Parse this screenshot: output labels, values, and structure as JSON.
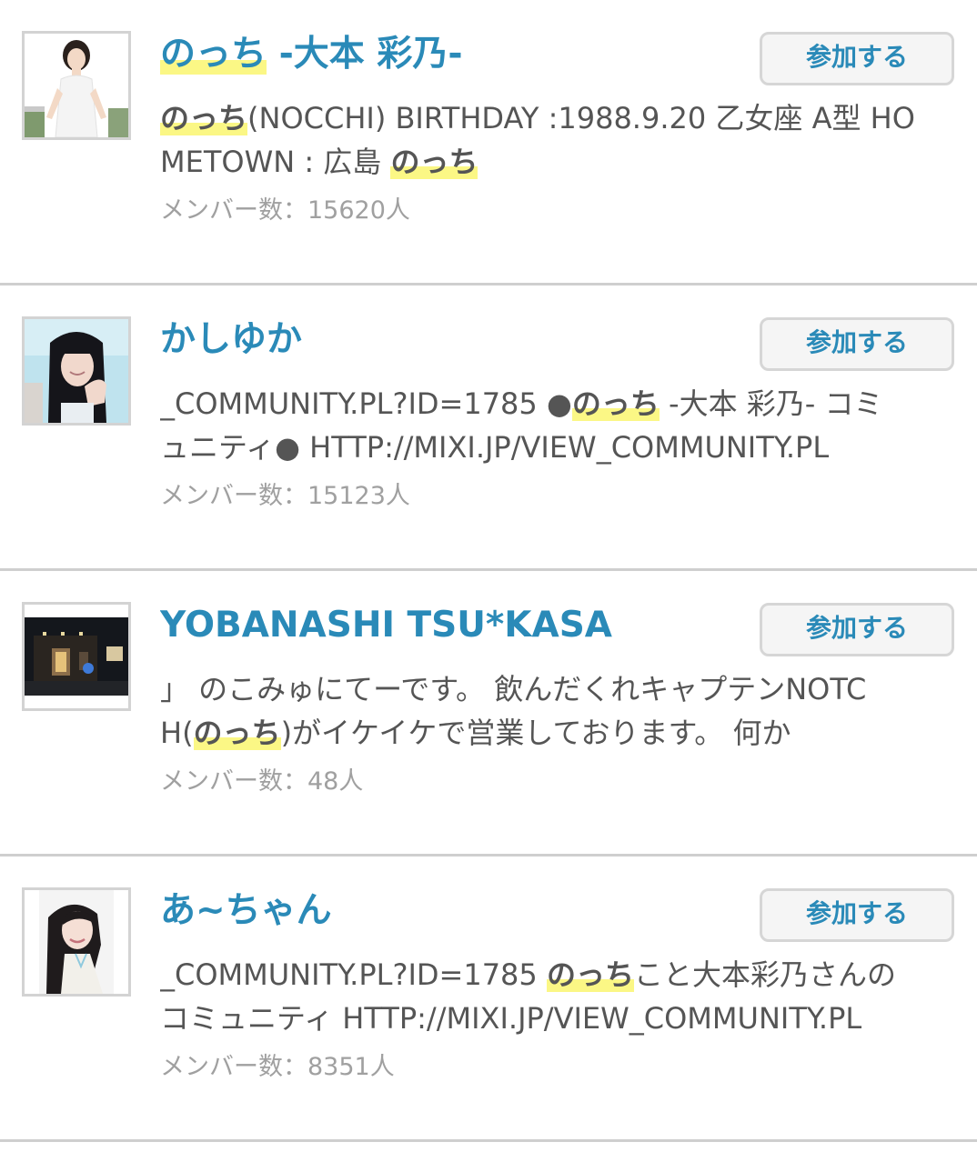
{
  "items": [
    {
      "thumbnail_icon": "woman-white-dress-photo",
      "title_highlight": "のっち",
      "title_rest": " -大本 彩乃-",
      "join_label": "参加する",
      "desc_line1": [
        {
          "text": "のっち",
          "hl": true
        },
        {
          "text": "(NOCCHI) BIRTHDAY :1988.9.20 乙女座 A型 HO",
          "hl": false
        }
      ],
      "desc_line2": [
        {
          "text": "METOWN : 広島 ",
          "hl": false
        },
        {
          "text": "のっち",
          "hl": true
        }
      ],
      "member_count": "メンバー数：15620人"
    },
    {
      "thumbnail_icon": "woman-black-hair-photo",
      "title_highlight": "",
      "title_rest": "かしゆか",
      "join_label": "参加する",
      "desc_line1": [
        {
          "text": "_COMMUNITY.PL?ID=1785 ●",
          "hl": false
        },
        {
          "text": "のっち",
          "hl": true
        },
        {
          "text": " -大本 彩乃- コミ",
          "hl": false
        }
      ],
      "desc_line2": [
        {
          "text": "ュニティ● HTTP://MIXI.JP/VIEW_COMMUNITY.PL",
          "hl": false
        }
      ],
      "member_count": "メンバー数：15123人"
    },
    {
      "thumbnail_icon": "night-building-photo",
      "title_highlight": "",
      "title_rest": "YOBANASHI TSU*KASA",
      "join_label": "参加する",
      "desc_line1": [
        {
          "text": "」 のこみゅにてーです。 飲んだくれキャプテンNOTC",
          "hl": false
        }
      ],
      "desc_line2": [
        {
          "text": "H(",
          "hl": false
        },
        {
          "text": "のっち",
          "hl": true
        },
        {
          "text": ")がイケイケで営業しております。 何か",
          "hl": false
        }
      ],
      "member_count": "メンバー数：48人"
    },
    {
      "thumbnail_icon": "smiling-woman-photo",
      "title_highlight": "",
      "title_rest": "あ~ちゃん",
      "join_label": "参加する",
      "desc_line1": [
        {
          "text": "_COMMUNITY.PL?ID=1785 ",
          "hl": false
        },
        {
          "text": "のっち",
          "hl": true
        },
        {
          "text": "こと大本彩乃さんの",
          "hl": false
        }
      ],
      "desc_line2": [
        {
          "text": "コミュニティ HTTP://MIXI.JP/VIEW_COMMUNITY.PL",
          "hl": false
        }
      ],
      "member_count": "メンバー数：8351人"
    }
  ],
  "colors": {
    "title": "#2a8ab8",
    "highlight": "#fbf785",
    "body_text": "#555555",
    "member_text": "#a0a0a0",
    "divider": "#cfcfcf"
  }
}
